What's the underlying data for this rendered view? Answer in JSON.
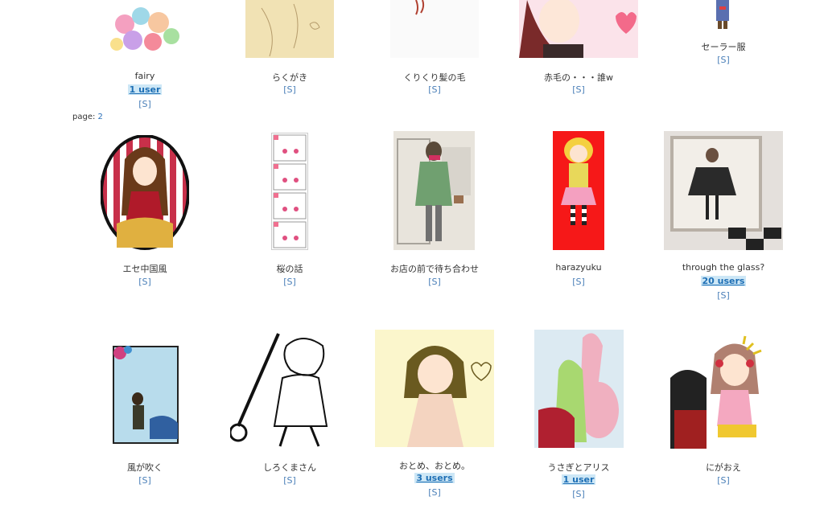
{
  "row1": [
    {
      "title": "fairy",
      "users": "1 user",
      "s": "[S]"
    },
    {
      "title": "らくがき",
      "users": "",
      "s": "[S]"
    },
    {
      "title": "くりくり髪の毛",
      "users": "",
      "s": "[S]"
    },
    {
      "title": "赤毛の・・・誰w",
      "users": "",
      "s": "[S]"
    },
    {
      "title": "セーラー服",
      "users": "",
      "s": "[S]"
    }
  ],
  "pager": {
    "label": "page:",
    "page": "2"
  },
  "row2": [
    {
      "title": "エセ中国風",
      "users": "",
      "s": "[S]"
    },
    {
      "title": "桜の話",
      "users": "",
      "s": "[S]"
    },
    {
      "title": "お店の前で待ち合わせ",
      "users": "",
      "s": "[S]"
    },
    {
      "title": "harazyuku",
      "users": "",
      "s": "[S]"
    },
    {
      "title": "through the glass?",
      "users": "20 users",
      "s": "[S]"
    }
  ],
  "row3": [
    {
      "title": "風が吹く",
      "users": "",
      "s": "[S]"
    },
    {
      "title": "しろくまさん",
      "users": "",
      "s": "[S]"
    },
    {
      "title": "おとめ、おとめ。",
      "users": "3 users",
      "s": "[S]"
    },
    {
      "title": "うさぎとアリス",
      "users": "1 user",
      "s": "[S]"
    },
    {
      "title": "にがおえ",
      "users": "",
      "s": "[S]"
    }
  ]
}
